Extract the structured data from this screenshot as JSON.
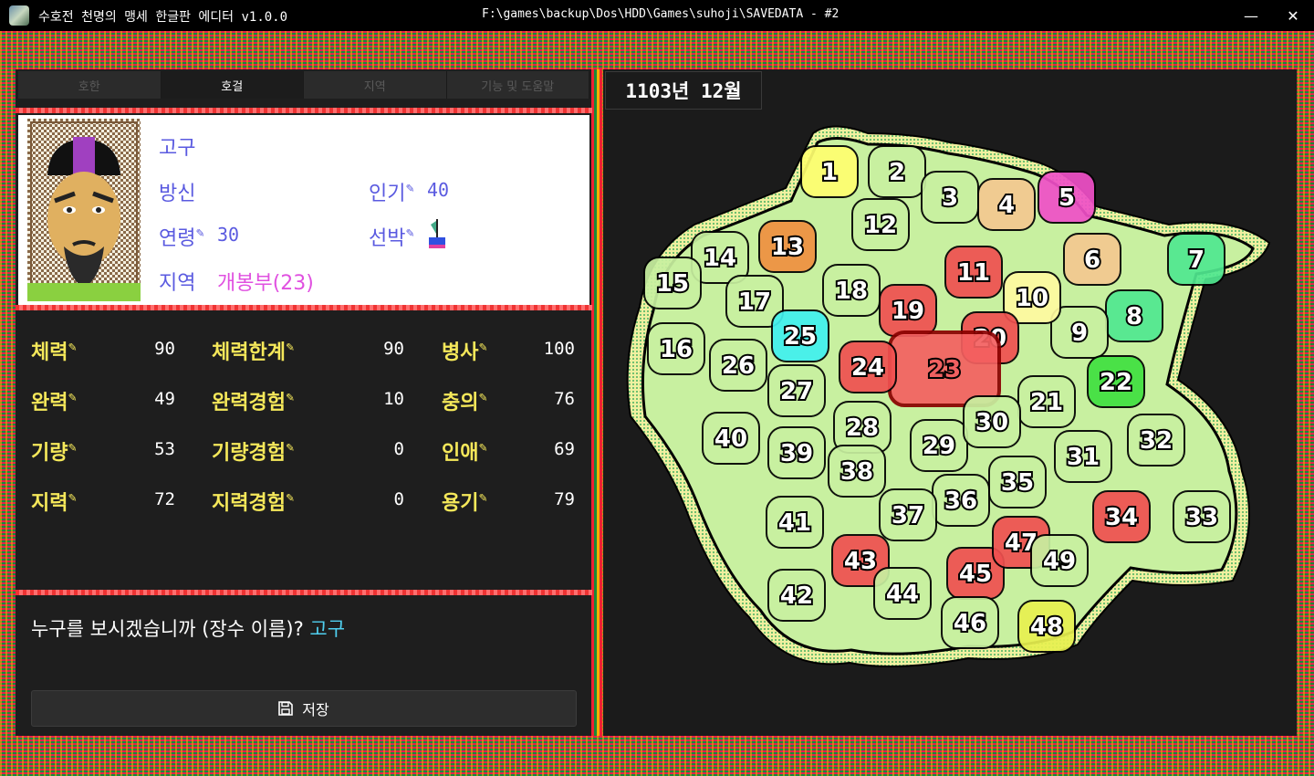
{
  "window": {
    "title": "수호전 천명의 맹세 한글판 에디터 v1.0.0",
    "path": "F:\\games\\backup\\Dos\\HDD\\Games\\suhoji\\SAVEDATA - #2",
    "minimize": "—",
    "maximize": "☐",
    "close": "✕"
  },
  "tabs": [
    {
      "label": "호한"
    },
    {
      "label": "호걸"
    },
    {
      "label": "지역"
    },
    {
      "label": "기능 및 도움말"
    }
  ],
  "profile": {
    "name": "고구",
    "title": "방신",
    "popularity_label": "인기",
    "popularity_value": "40",
    "age_label": "연령",
    "age_value": "30",
    "ship_label": "선박",
    "region_label": "지역",
    "region_value": "개봉부(23)"
  },
  "stats": [
    {
      "label": "체력",
      "value": "90"
    },
    {
      "label": "체력한계",
      "value": "90"
    },
    {
      "label": "병사",
      "value": "100"
    },
    {
      "label": "완력",
      "value": "49"
    },
    {
      "label": "완력경험",
      "value": "10"
    },
    {
      "label": "충의",
      "value": "76"
    },
    {
      "label": "기량",
      "value": "53"
    },
    {
      "label": "기량경험",
      "value": "0"
    },
    {
      "label": "인애",
      "value": "69"
    },
    {
      "label": "지력",
      "value": "72"
    },
    {
      "label": "지력경험",
      "value": "0"
    },
    {
      "label": "용기",
      "value": "79"
    }
  ],
  "prompt": {
    "question": "누구를 보시겠습니까 (장수 이름)?",
    "input": "고구"
  },
  "save_label": "저장",
  "date": "1103년 12월",
  "map": {
    "selected_region": "23",
    "regions": [
      {
        "n": "1",
        "fill": "#ffff70"
      },
      {
        "n": "2",
        "fill": "#c8f0a0"
      },
      {
        "n": "3",
        "fill": "#c8f0a0"
      },
      {
        "n": "4",
        "fill": "#f4c890"
      },
      {
        "n": "5",
        "fill": "#f050c8"
      },
      {
        "n": "6",
        "fill": "#f4c890"
      },
      {
        "n": "7",
        "fill": "#50e890"
      },
      {
        "n": "8",
        "fill": "#50e890"
      },
      {
        "n": "9",
        "fill": "#c8f0a0"
      },
      {
        "n": "10",
        "fill": "#fffaa0"
      },
      {
        "n": "11",
        "fill": "#f05050"
      },
      {
        "n": "12",
        "fill": "#c8f0a0"
      },
      {
        "n": "13",
        "fill": "#f09040"
      },
      {
        "n": "14",
        "fill": "#c8f0a0"
      },
      {
        "n": "15",
        "fill": "#c8f0a0"
      },
      {
        "n": "16",
        "fill": "#c8f0a0"
      },
      {
        "n": "17",
        "fill": "#c8f0a0"
      },
      {
        "n": "18",
        "fill": "#c8f0a0"
      },
      {
        "n": "19",
        "fill": "#f05050"
      },
      {
        "n": "20",
        "fill": "#f05050"
      },
      {
        "n": "21",
        "fill": "#c8f0a0"
      },
      {
        "n": "22",
        "fill": "#40e040"
      },
      {
        "n": "23",
        "fill": "#f46060"
      },
      {
        "n": "24",
        "fill": "#f05050"
      },
      {
        "n": "25",
        "fill": "#40f0f0"
      },
      {
        "n": "26",
        "fill": "#c8f0a0"
      },
      {
        "n": "27",
        "fill": "#c8f0a0"
      },
      {
        "n": "28",
        "fill": "#c8f0a0"
      },
      {
        "n": "29",
        "fill": "#c8f0a0"
      },
      {
        "n": "30",
        "fill": "#c8f0a0"
      },
      {
        "n": "31",
        "fill": "#c8f0a0"
      },
      {
        "n": "32",
        "fill": "#c8f0a0"
      },
      {
        "n": "33",
        "fill": "#c8f0a0"
      },
      {
        "n": "34",
        "fill": "#f05050"
      },
      {
        "n": "35",
        "fill": "#c8f0a0"
      },
      {
        "n": "36",
        "fill": "#c8f0a0"
      },
      {
        "n": "37",
        "fill": "#c8f0a0"
      },
      {
        "n": "38",
        "fill": "#c8f0a0"
      },
      {
        "n": "39",
        "fill": "#c8f0a0"
      },
      {
        "n": "40",
        "fill": "#c8f0a0"
      },
      {
        "n": "41",
        "fill": "#c8f0a0"
      },
      {
        "n": "42",
        "fill": "#c8f0a0"
      },
      {
        "n": "43",
        "fill": "#f05050"
      },
      {
        "n": "44",
        "fill": "#c8f0a0"
      },
      {
        "n": "45",
        "fill": "#f05050"
      },
      {
        "n": "46",
        "fill": "#c8f0a0"
      },
      {
        "n": "47",
        "fill": "#f05050"
      },
      {
        "n": "48",
        "fill": "#e8f050"
      },
      {
        "n": "49",
        "fill": "#c8f0a0"
      }
    ]
  }
}
